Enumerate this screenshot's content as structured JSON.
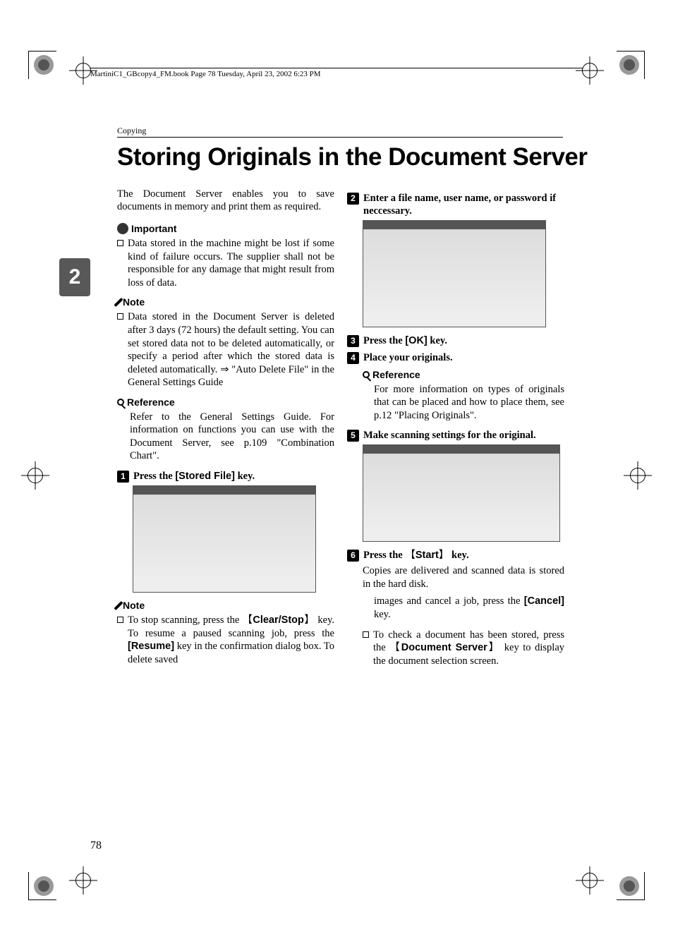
{
  "header_text": "MartiniC1_GBcopy4_FM.book  Page 78  Tuesday, April 23, 2002  6:23 PM",
  "chapter_label": "Copying",
  "side_tab": "2",
  "page_number": "78",
  "title": "Storing Originals in the Document Server",
  "intro": "The Document Server enables you to save documents in memory and print them as required.",
  "important_label": "Important",
  "important_item": "Data stored in the machine might be lost if some kind of failure occurs. The supplier shall not be responsible for any damage that might result from loss of data.",
  "note_label": "Note",
  "note_item": "Data stored in the Document Server is deleted after 3 days (72 hours) the default setting. You can set stored data not to be deleted automatically, or specify a period after which the stored data is deleted automatically. ⇒ \"Auto Delete File\" in the General Settings Guide",
  "reference_label": "Reference",
  "reference_body": "Refer to the General Settings Guide. For information on functions you can use with the Document Server, see p.109 \"Combination Chart\".",
  "step1_pre": "Press the ",
  "step1_key": "[Stored File]",
  "step1_post": " key.",
  "note2_pre": "To stop scanning, press the ",
  "note2_key1": "Clear/Stop",
  "note2_mid": " key. To resume a paused scanning job, press the ",
  "note2_key2": "[Resume]",
  "note2_post": " key in the confirmation dialog box. To delete saved",
  "step2": "Enter a file name, user name, or password if neccessary.",
  "step3_pre": "Press the ",
  "step3_key": "[OK]",
  "step3_post": " key.",
  "step4": "Place your originals.",
  "reference2_body": "For more information on types of originals that can be placed and how to place them, see p.12 \"Placing Originals\".",
  "step5": "Make scanning settings for the original.",
  "step6_pre": "Press the ",
  "step6_key": "Start",
  "step6_post": " key.",
  "step6_body": "Copies are delivered and scanned data is stored in the hard disk.",
  "tail1_pre": "images and cancel a job, press the ",
  "tail1_key": "[Cancel]",
  "tail1_post": " key.",
  "tail2_pre": "To check a document has been stored, press the ",
  "tail2_key": "Document Server",
  "tail2_post": " key to display the document selection screen."
}
